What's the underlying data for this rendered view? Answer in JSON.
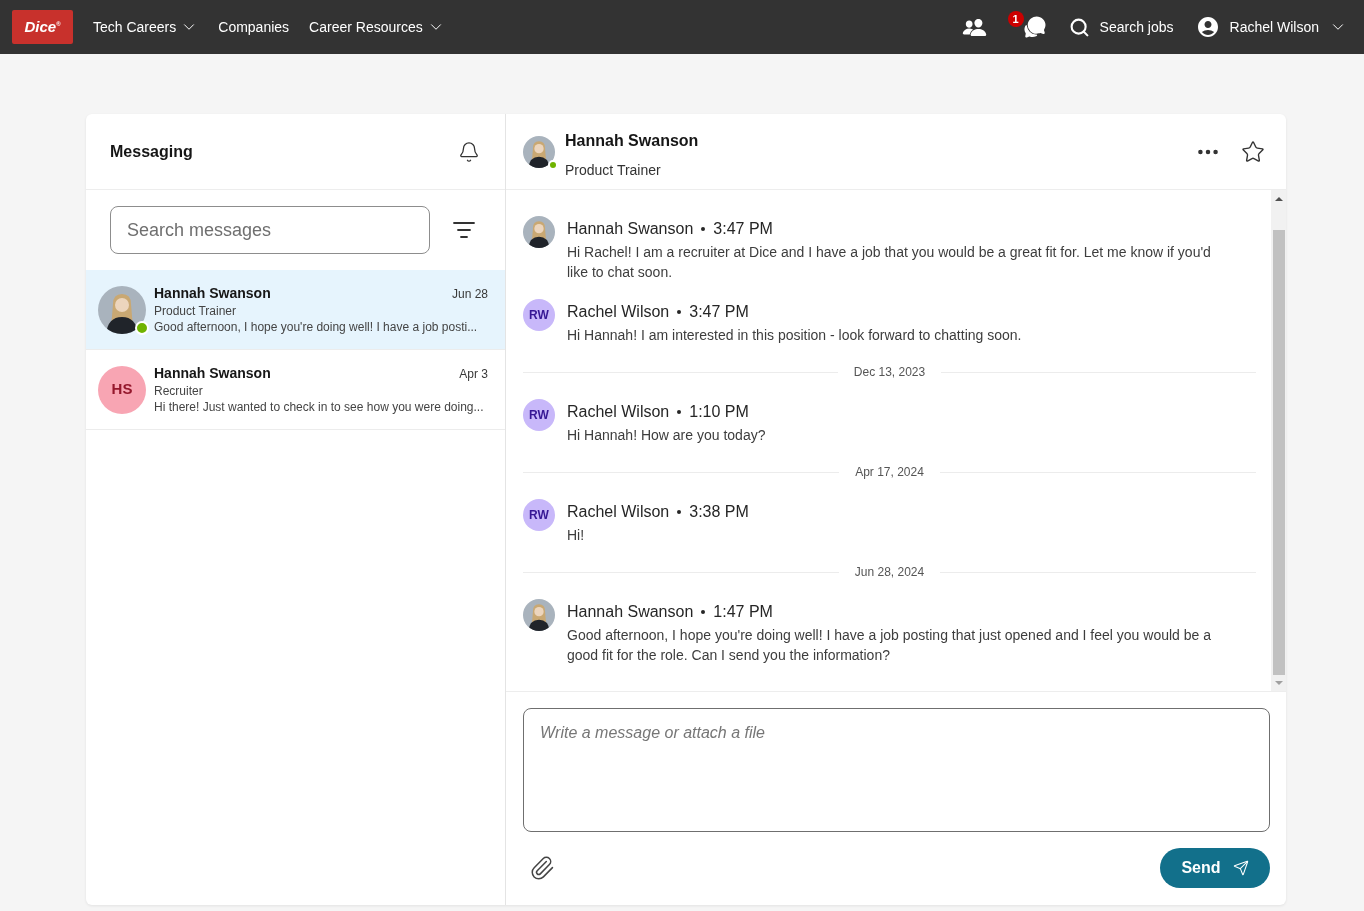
{
  "nav": {
    "logo": "Dice$^{®}$",
    "links": [
      {
        "label": "Tech Careers",
        "dropdown": true
      },
      {
        "label": "Companies",
        "dropdown": false
      },
      {
        "label": "Career Resources",
        "dropdown": true
      }
    ],
    "messages_badge": "1",
    "search_label": "Search jobs",
    "user": {
      "name": "Rachel Wilson",
      "dropdown": true
    }
  },
  "sidebar": {
    "title": "Messaging",
    "search": {
      "placeholder": "Search messages"
    },
    "conversations": [
      {
        "name": "Hannah Swanson",
        "date": "Jun 28",
        "role": "Product Trainer",
        "preview": "Good afternoon, I hope you're doing well! I have a job posti...",
        "avatar": {
          "kind": "photo"
        },
        "online": true,
        "selected": true
      },
      {
        "name": "Hannah Swanson",
        "date": "Apr 3",
        "role": "Recruiter",
        "preview": "Hi there! Just wanted to check in to see how you were doing...",
        "avatar": {
          "kind": "initials",
          "initials": "HS",
          "color": "#f8a5b3"
        },
        "online": false,
        "selected": false
      }
    ]
  },
  "chat": {
    "header": {
      "name": "Hannah Swanson",
      "role": "Product Trainer",
      "avatar": {
        "kind": "photo"
      },
      "online": true
    },
    "timeline": [
      {
        "kind": "message",
        "sender": "Hannah Swanson",
        "time": "3:47 PM",
        "text": "Hi Rachel! I am a recruiter at Dice and I have a job that you would be a great fit for. Let me know if you'd like to chat soon.",
        "avatar": {
          "kind": "photo"
        }
      },
      {
        "kind": "message",
        "sender": "Rachel Wilson",
        "time": "3:47 PM",
        "text": "Hi Hannah! I am interested in this position - look forward to chatting soon.",
        "avatar": {
          "kind": "initials",
          "initials": "RW",
          "color": "#c8b8fa"
        }
      },
      {
        "kind": "date",
        "label": "Dec 13, 2023"
      },
      {
        "kind": "message",
        "sender": "Rachel Wilson",
        "time": "1:10 PM",
        "text": "Hi Hannah! How are you today?",
        "avatar": {
          "kind": "initials",
          "initials": "RW",
          "color": "#c8b8fa"
        }
      },
      {
        "kind": "date",
        "label": "Apr 17, 2024"
      },
      {
        "kind": "message",
        "sender": "Rachel Wilson",
        "time": "3:38 PM",
        "text": "Hi!",
        "avatar": {
          "kind": "initials",
          "initials": "RW",
          "color": "#c8b8fa"
        }
      },
      {
        "kind": "date",
        "label": "Jun 28, 2024"
      },
      {
        "kind": "message",
        "sender": "Hannah Swanson",
        "time": "1:47 PM",
        "text": "Good afternoon, I hope you're doing well! I have a job posting that just opened and I feel you would be a good fit for the role. Can I send you the information?",
        "avatar": {
          "kind": "photo"
        }
      }
    ],
    "composer": {
      "placeholder": "Write a message or attach a file"
    },
    "send_label": "Send"
  }
}
